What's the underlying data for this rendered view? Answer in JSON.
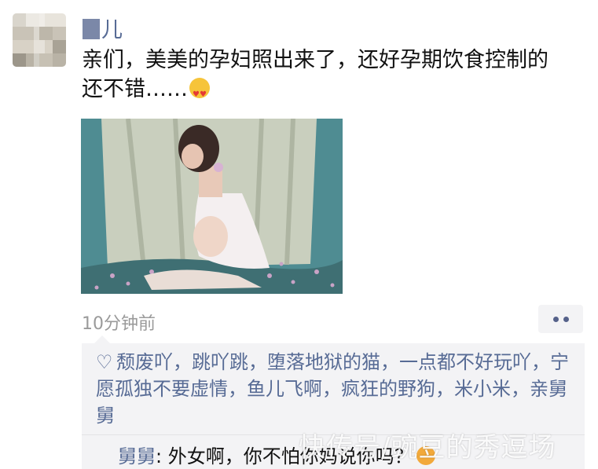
{
  "moment": {
    "author": "儿",
    "text": "亲们，美美的孕妇照出来了，还好孕期饮食控制的还不错……",
    "emoji": "heart-eyes-emoji",
    "time": "10分钟前"
  },
  "likes": {
    "icon": "heart-icon",
    "names": "颓废吖，跳吖跳，堕落地狱的猫，一点都不好玩吖，宁愿孤独不要虚情，鱼儿飞啊，疯狂的野狗，米小米，亲舅舅"
  },
  "comment": {
    "author": "舅舅",
    "separator": ": ",
    "text": "外女啊，你不怕你妈说你吗？",
    "emoji": "grimace-emoji"
  },
  "watermark": "快传号/豌豆的秀逗场",
  "colors": {
    "link": "#576b95",
    "panel": "#f3f3f5",
    "time": "#9a9a9a"
  }
}
